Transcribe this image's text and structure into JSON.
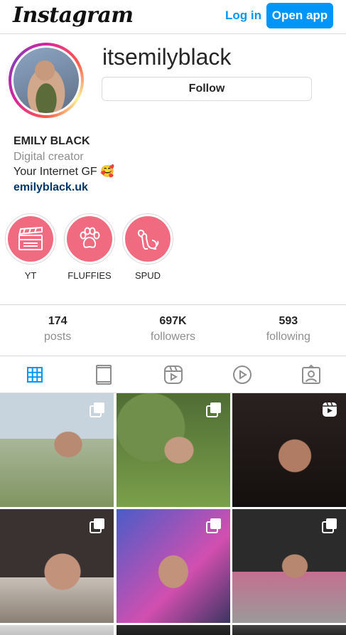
{
  "header": {
    "logo": "Instagram",
    "login_label": "Log in",
    "open_app_label": "Open app"
  },
  "profile": {
    "username": "itsemilyblack",
    "follow_label": "Follow",
    "display_name": "EMILY BLACK",
    "category": "Digital creator",
    "bio": "Your Internet GF 🥰",
    "link": "emilyblack.uk"
  },
  "highlights": [
    {
      "label": "YT",
      "icon": "clapperboard-icon"
    },
    {
      "label": "FLUFFIES",
      "icon": "paw-icon"
    },
    {
      "label": "SPUD",
      "icon": "dog-icon"
    }
  ],
  "stats": {
    "posts": {
      "count": "174",
      "label": "posts"
    },
    "followers": {
      "count": "697K",
      "label": "followers"
    },
    "following": {
      "count": "593",
      "label": "following"
    }
  },
  "tabs": [
    {
      "name": "grid-icon",
      "active": true
    },
    {
      "name": "feed-icon",
      "active": false
    },
    {
      "name": "reels-icon",
      "active": false
    },
    {
      "name": "video-icon",
      "active": false
    },
    {
      "name": "tagged-icon",
      "active": false
    }
  ],
  "posts": [
    {
      "type": "carousel"
    },
    {
      "type": "carousel"
    },
    {
      "type": "reel"
    },
    {
      "type": "carousel"
    },
    {
      "type": "carousel"
    },
    {
      "type": "carousel"
    }
  ],
  "colors": {
    "accent": "#0095f6",
    "highlight_fill": "#f06b80",
    "link": "#00376b",
    "muted": "#8e8e8e",
    "border": "#dbdbdb"
  }
}
